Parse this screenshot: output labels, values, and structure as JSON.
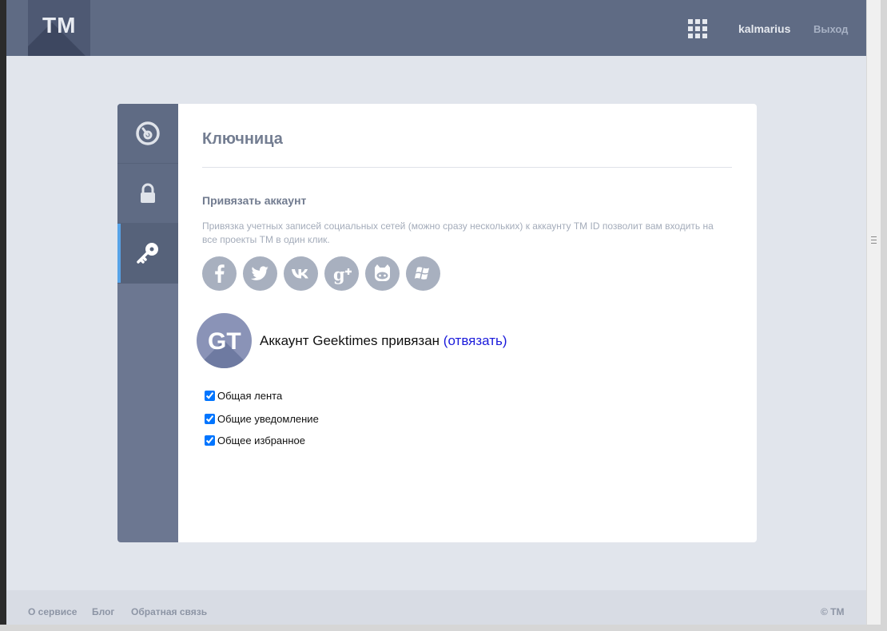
{
  "header": {
    "logo": "TM",
    "username": "kalmarius",
    "logout_label": "Выход"
  },
  "sidebar": {
    "items": [
      {
        "icon": "dashboard-icon"
      },
      {
        "icon": "lock-icon"
      },
      {
        "icon": "key-icon",
        "active": true
      }
    ]
  },
  "main": {
    "title": "Ключница",
    "section_title": "Привязать аккаунт",
    "section_desc": "Привязка учетных записей социальных сетей (можно сразу нескольких) к аккаунту TM ID позволит вам входить на все проекты TM в один клик.",
    "socials": [
      "facebook-icon",
      "twitter-icon",
      "vk-icon",
      "google-plus-icon",
      "github-icon",
      "windows-icon"
    ],
    "linked": {
      "avatar_text": "GT",
      "text": "Аккаунт Geektimes привязан",
      "unlink_label": "(отвязать)"
    },
    "options": [
      {
        "label": "Общая лента",
        "checked": true
      },
      {
        "label": "Общие уведомление",
        "checked": true
      },
      {
        "label": "Общее избранное",
        "checked": true
      }
    ]
  },
  "footer": {
    "links": [
      "О сервисе",
      "Блог",
      "Обратная связь"
    ],
    "copyright": "© TM"
  },
  "colors": {
    "header_bg": "#5f6b84",
    "sidebar_bg": "#6c7791",
    "active_accent": "#57a3e7",
    "social_bg": "#a8b0bf",
    "link": "#1a1adb"
  }
}
